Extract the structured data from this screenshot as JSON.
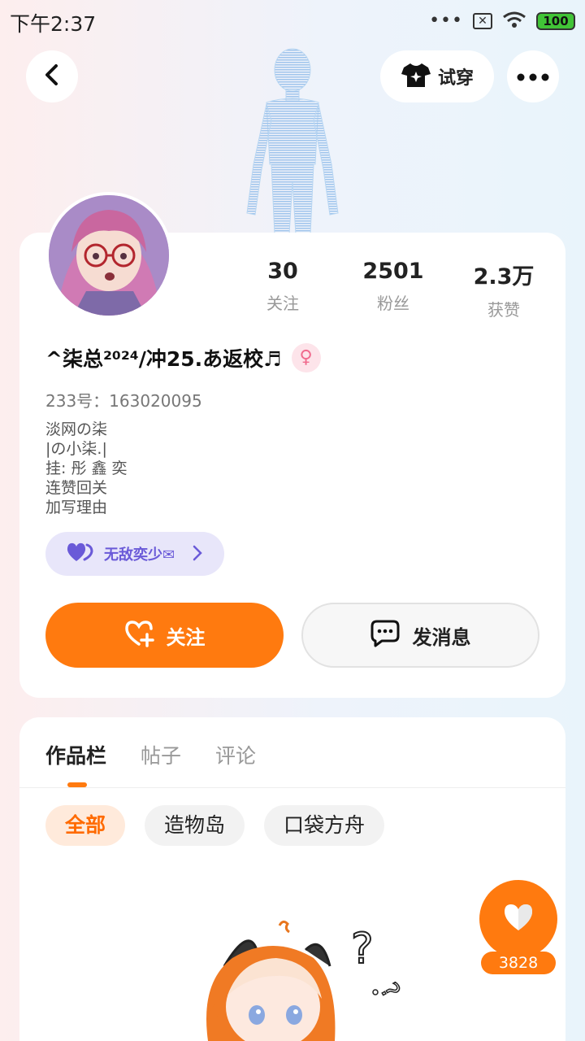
{
  "status_bar": {
    "time": "下午2:37",
    "dots": "•••",
    "x_icon": "✕",
    "battery": "100"
  },
  "header": {
    "try_on_label": "试穿"
  },
  "profile": {
    "stats": [
      {
        "value": "30",
        "label": "关注"
      },
      {
        "value": "2501",
        "label": "粉丝"
      },
      {
        "value": "2.3万",
        "label": "获赞"
      }
    ],
    "nickname": "^柒总²⁰²⁴/冲25.あ返校♬",
    "gender_icon": "♀",
    "uid": "233号：163020095",
    "bio_lines": [
      "淡网の柒",
      "|の小柒.|",
      "挂: 彤 鑫 奕",
      "连赞回关",
      "加写理由"
    ],
    "guild_name": "无敌奕少✉",
    "follow_label": "关注",
    "message_label": "发消息"
  },
  "works": {
    "tabs": [
      "作品栏",
      "帖子",
      "评论"
    ],
    "filters": [
      "全部",
      "造物岛",
      "口袋方舟"
    ]
  },
  "like": {
    "count": "3828"
  },
  "colors": {
    "accent": "#ff7a0f",
    "guild_text": "#6a5ad8",
    "guild_bg": "#e8e6fa"
  }
}
